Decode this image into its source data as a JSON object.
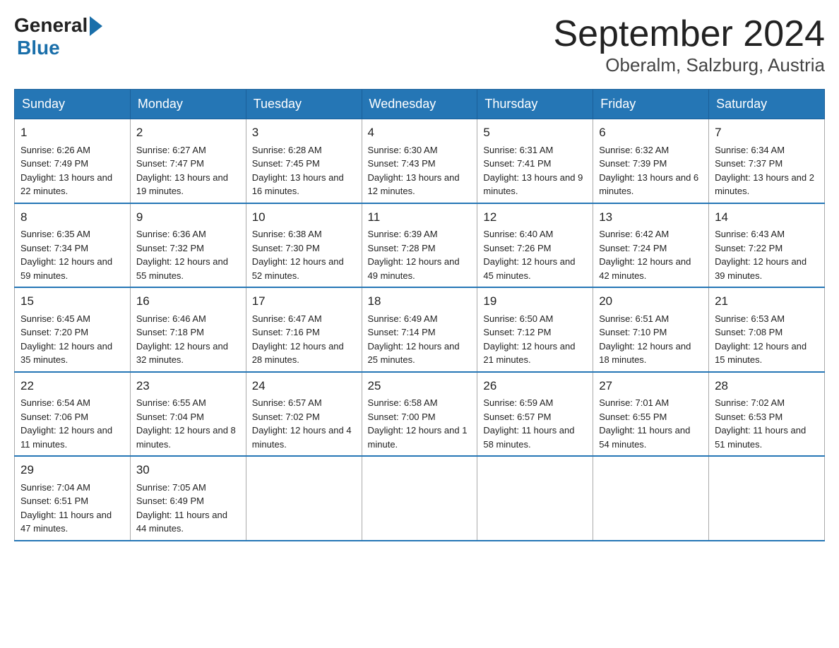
{
  "header": {
    "logo_general": "General",
    "logo_blue": "Blue",
    "title": "September 2024",
    "subtitle": "Oberalm, Salzburg, Austria"
  },
  "days_of_week": [
    "Sunday",
    "Monday",
    "Tuesday",
    "Wednesday",
    "Thursday",
    "Friday",
    "Saturday"
  ],
  "weeks": [
    [
      {
        "day": "1",
        "sunrise": "Sunrise: 6:26 AM",
        "sunset": "Sunset: 7:49 PM",
        "daylight": "Daylight: 13 hours and 22 minutes."
      },
      {
        "day": "2",
        "sunrise": "Sunrise: 6:27 AM",
        "sunset": "Sunset: 7:47 PM",
        "daylight": "Daylight: 13 hours and 19 minutes."
      },
      {
        "day": "3",
        "sunrise": "Sunrise: 6:28 AM",
        "sunset": "Sunset: 7:45 PM",
        "daylight": "Daylight: 13 hours and 16 minutes."
      },
      {
        "day": "4",
        "sunrise": "Sunrise: 6:30 AM",
        "sunset": "Sunset: 7:43 PM",
        "daylight": "Daylight: 13 hours and 12 minutes."
      },
      {
        "day": "5",
        "sunrise": "Sunrise: 6:31 AM",
        "sunset": "Sunset: 7:41 PM",
        "daylight": "Daylight: 13 hours and 9 minutes."
      },
      {
        "day": "6",
        "sunrise": "Sunrise: 6:32 AM",
        "sunset": "Sunset: 7:39 PM",
        "daylight": "Daylight: 13 hours and 6 minutes."
      },
      {
        "day": "7",
        "sunrise": "Sunrise: 6:34 AM",
        "sunset": "Sunset: 7:37 PM",
        "daylight": "Daylight: 13 hours and 2 minutes."
      }
    ],
    [
      {
        "day": "8",
        "sunrise": "Sunrise: 6:35 AM",
        "sunset": "Sunset: 7:34 PM",
        "daylight": "Daylight: 12 hours and 59 minutes."
      },
      {
        "day": "9",
        "sunrise": "Sunrise: 6:36 AM",
        "sunset": "Sunset: 7:32 PM",
        "daylight": "Daylight: 12 hours and 55 minutes."
      },
      {
        "day": "10",
        "sunrise": "Sunrise: 6:38 AM",
        "sunset": "Sunset: 7:30 PM",
        "daylight": "Daylight: 12 hours and 52 minutes."
      },
      {
        "day": "11",
        "sunrise": "Sunrise: 6:39 AM",
        "sunset": "Sunset: 7:28 PM",
        "daylight": "Daylight: 12 hours and 49 minutes."
      },
      {
        "day": "12",
        "sunrise": "Sunrise: 6:40 AM",
        "sunset": "Sunset: 7:26 PM",
        "daylight": "Daylight: 12 hours and 45 minutes."
      },
      {
        "day": "13",
        "sunrise": "Sunrise: 6:42 AM",
        "sunset": "Sunset: 7:24 PM",
        "daylight": "Daylight: 12 hours and 42 minutes."
      },
      {
        "day": "14",
        "sunrise": "Sunrise: 6:43 AM",
        "sunset": "Sunset: 7:22 PM",
        "daylight": "Daylight: 12 hours and 39 minutes."
      }
    ],
    [
      {
        "day": "15",
        "sunrise": "Sunrise: 6:45 AM",
        "sunset": "Sunset: 7:20 PM",
        "daylight": "Daylight: 12 hours and 35 minutes."
      },
      {
        "day": "16",
        "sunrise": "Sunrise: 6:46 AM",
        "sunset": "Sunset: 7:18 PM",
        "daylight": "Daylight: 12 hours and 32 minutes."
      },
      {
        "day": "17",
        "sunrise": "Sunrise: 6:47 AM",
        "sunset": "Sunset: 7:16 PM",
        "daylight": "Daylight: 12 hours and 28 minutes."
      },
      {
        "day": "18",
        "sunrise": "Sunrise: 6:49 AM",
        "sunset": "Sunset: 7:14 PM",
        "daylight": "Daylight: 12 hours and 25 minutes."
      },
      {
        "day": "19",
        "sunrise": "Sunrise: 6:50 AM",
        "sunset": "Sunset: 7:12 PM",
        "daylight": "Daylight: 12 hours and 21 minutes."
      },
      {
        "day": "20",
        "sunrise": "Sunrise: 6:51 AM",
        "sunset": "Sunset: 7:10 PM",
        "daylight": "Daylight: 12 hours and 18 minutes."
      },
      {
        "day": "21",
        "sunrise": "Sunrise: 6:53 AM",
        "sunset": "Sunset: 7:08 PM",
        "daylight": "Daylight: 12 hours and 15 minutes."
      }
    ],
    [
      {
        "day": "22",
        "sunrise": "Sunrise: 6:54 AM",
        "sunset": "Sunset: 7:06 PM",
        "daylight": "Daylight: 12 hours and 11 minutes."
      },
      {
        "day": "23",
        "sunrise": "Sunrise: 6:55 AM",
        "sunset": "Sunset: 7:04 PM",
        "daylight": "Daylight: 12 hours and 8 minutes."
      },
      {
        "day": "24",
        "sunrise": "Sunrise: 6:57 AM",
        "sunset": "Sunset: 7:02 PM",
        "daylight": "Daylight: 12 hours and 4 minutes."
      },
      {
        "day": "25",
        "sunrise": "Sunrise: 6:58 AM",
        "sunset": "Sunset: 7:00 PM",
        "daylight": "Daylight: 12 hours and 1 minute."
      },
      {
        "day": "26",
        "sunrise": "Sunrise: 6:59 AM",
        "sunset": "Sunset: 6:57 PM",
        "daylight": "Daylight: 11 hours and 58 minutes."
      },
      {
        "day": "27",
        "sunrise": "Sunrise: 7:01 AM",
        "sunset": "Sunset: 6:55 PM",
        "daylight": "Daylight: 11 hours and 54 minutes."
      },
      {
        "day": "28",
        "sunrise": "Sunrise: 7:02 AM",
        "sunset": "Sunset: 6:53 PM",
        "daylight": "Daylight: 11 hours and 51 minutes."
      }
    ],
    [
      {
        "day": "29",
        "sunrise": "Sunrise: 7:04 AM",
        "sunset": "Sunset: 6:51 PM",
        "daylight": "Daylight: 11 hours and 47 minutes."
      },
      {
        "day": "30",
        "sunrise": "Sunrise: 7:05 AM",
        "sunset": "Sunset: 6:49 PM",
        "daylight": "Daylight: 11 hours and 44 minutes."
      },
      null,
      null,
      null,
      null,
      null
    ]
  ]
}
